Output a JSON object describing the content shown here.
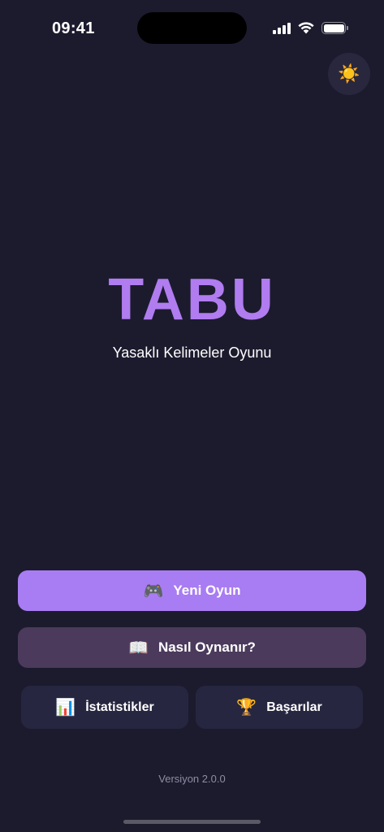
{
  "status_bar": {
    "time": "09:41"
  },
  "theme_toggle": {
    "icon": "☀️"
  },
  "app": {
    "title": "TABU",
    "subtitle": "Yasaklı Kelimeler Oyunu"
  },
  "buttons": {
    "new_game": {
      "icon": "🎮",
      "label": "Yeni Oyun"
    },
    "how_to_play": {
      "icon": "📖",
      "label": "Nasıl Oynanır?"
    },
    "statistics": {
      "icon": "📊",
      "label": "İstatistikler"
    },
    "achievements": {
      "icon": "🏆",
      "label": "Başarılar"
    }
  },
  "footer": {
    "version": "Versiyon 2.0.0"
  },
  "colors": {
    "background": "#1c1b2e",
    "accent": "#a87cf2",
    "title": "#b07cf0",
    "secondary_button": "#4b3a5c",
    "tile_button": "#262640"
  }
}
